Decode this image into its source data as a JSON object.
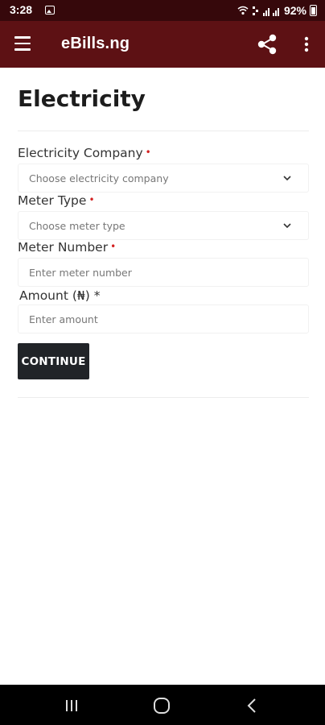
{
  "status_bar": {
    "time": "3:28",
    "battery": "92%",
    "left_icon": "image-icon",
    "right_icons": [
      "hotspot-icon",
      "volte-icon",
      "signal-icon",
      "battery-icon"
    ]
  },
  "app_bar": {
    "title": "eBills.ng",
    "icons": [
      "menu-icon",
      "share-icon",
      "more-vertical-icon"
    ],
    "background": "#5d1114"
  },
  "page": {
    "title": "Electricity"
  },
  "form": {
    "company": {
      "label": "Electricity Company",
      "required_mark": "•",
      "placeholder": "Choose electricity company"
    },
    "meter_type": {
      "label": "Meter Type",
      "required_mark": "•",
      "placeholder": "Choose meter type"
    },
    "meter_number": {
      "label": "Meter Number",
      "required_mark": "•",
      "placeholder": "Enter meter number"
    },
    "amount": {
      "label": "Amount (₦) *",
      "placeholder": "Enter amount"
    },
    "continue_label": "CONTINUE"
  },
  "nav_bar": {
    "icons": [
      "recent-apps-icon",
      "home-icon",
      "back-icon"
    ]
  }
}
